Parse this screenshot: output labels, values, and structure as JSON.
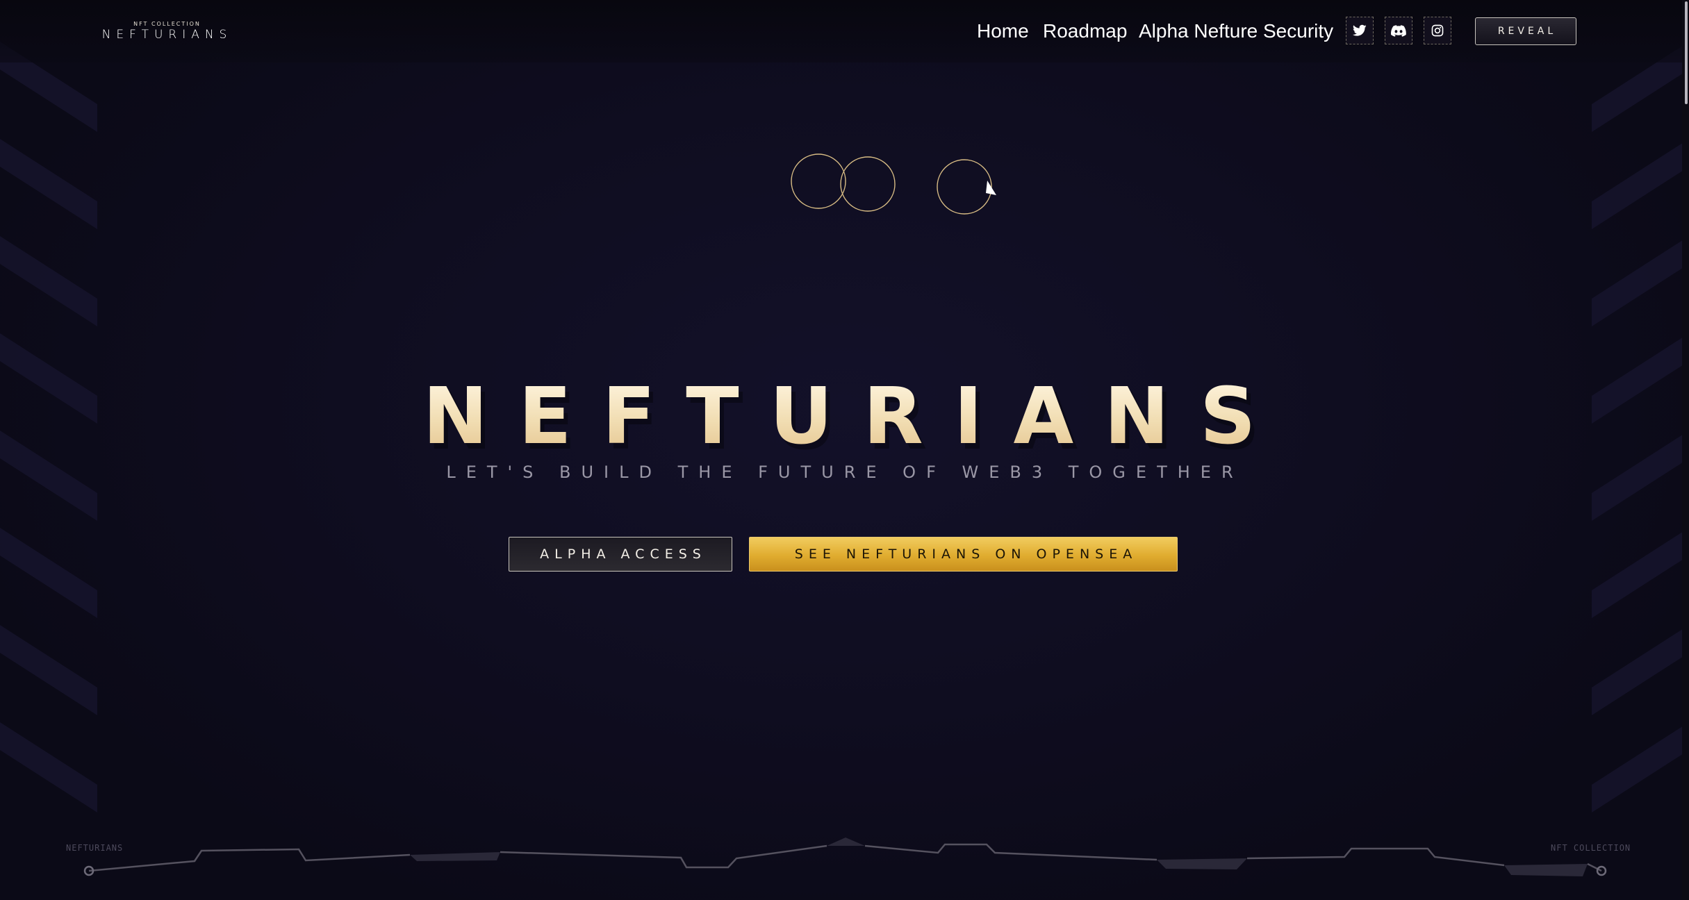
{
  "brand": {
    "subtitle": "NFT COLLECTION",
    "name": "NEFTURIANS"
  },
  "nav": {
    "items": [
      {
        "label": "Home"
      },
      {
        "label": "Roadmap"
      },
      {
        "label": "Alpha Nefture Security"
      }
    ],
    "social": [
      {
        "icon": "twitter-icon"
      },
      {
        "icon": "discord-icon"
      },
      {
        "icon": "instagram-icon"
      }
    ],
    "reveal_label": "REVEAL"
  },
  "hero": {
    "title": "NEFTURIANS",
    "tagline": "LET'S BUILD THE FUTURE OF WEB3 TOGETHER",
    "alpha_button": "ALPHA ACCESS",
    "opensea_button": "SEE NEFTURIANS ON OPENSEA"
  },
  "hud": {
    "left_label": "NEFTURIANS",
    "right_label": "NFT COLLECTION"
  },
  "colors": {
    "background": "#0f0d20",
    "gold": "#e0ac2f",
    "cream": "#f5e4bd",
    "muted": "#9a97a6"
  }
}
